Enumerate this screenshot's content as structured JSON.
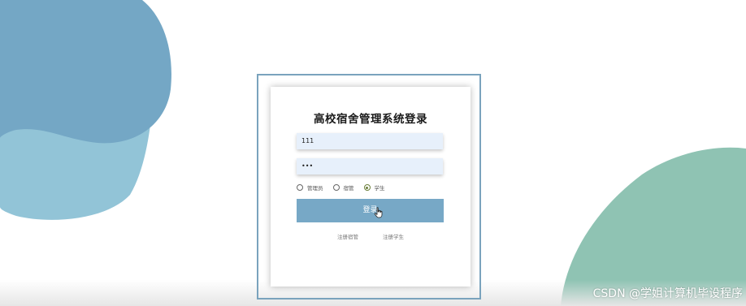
{
  "login": {
    "title": "高校宿舍管理系统登录",
    "username_value": "111",
    "password_value": "•••",
    "roles": [
      {
        "label": "管理员",
        "checked": false
      },
      {
        "label": "宿管",
        "checked": false
      },
      {
        "label": "学生",
        "checked": true
      }
    ],
    "login_button_label": "登录",
    "register_links": [
      "注册宿管",
      "注册学生"
    ]
  },
  "watermark": "CSDN @学姐计算机毕设程序",
  "colors": {
    "blob_dark_blue": "#74a7c5",
    "blob_light_blue": "#92c4d7",
    "blob_green": "#8fc3b3",
    "button": "#77a8c6",
    "frame": "#7aa3bd",
    "input_bg": "#e7f0fb"
  }
}
